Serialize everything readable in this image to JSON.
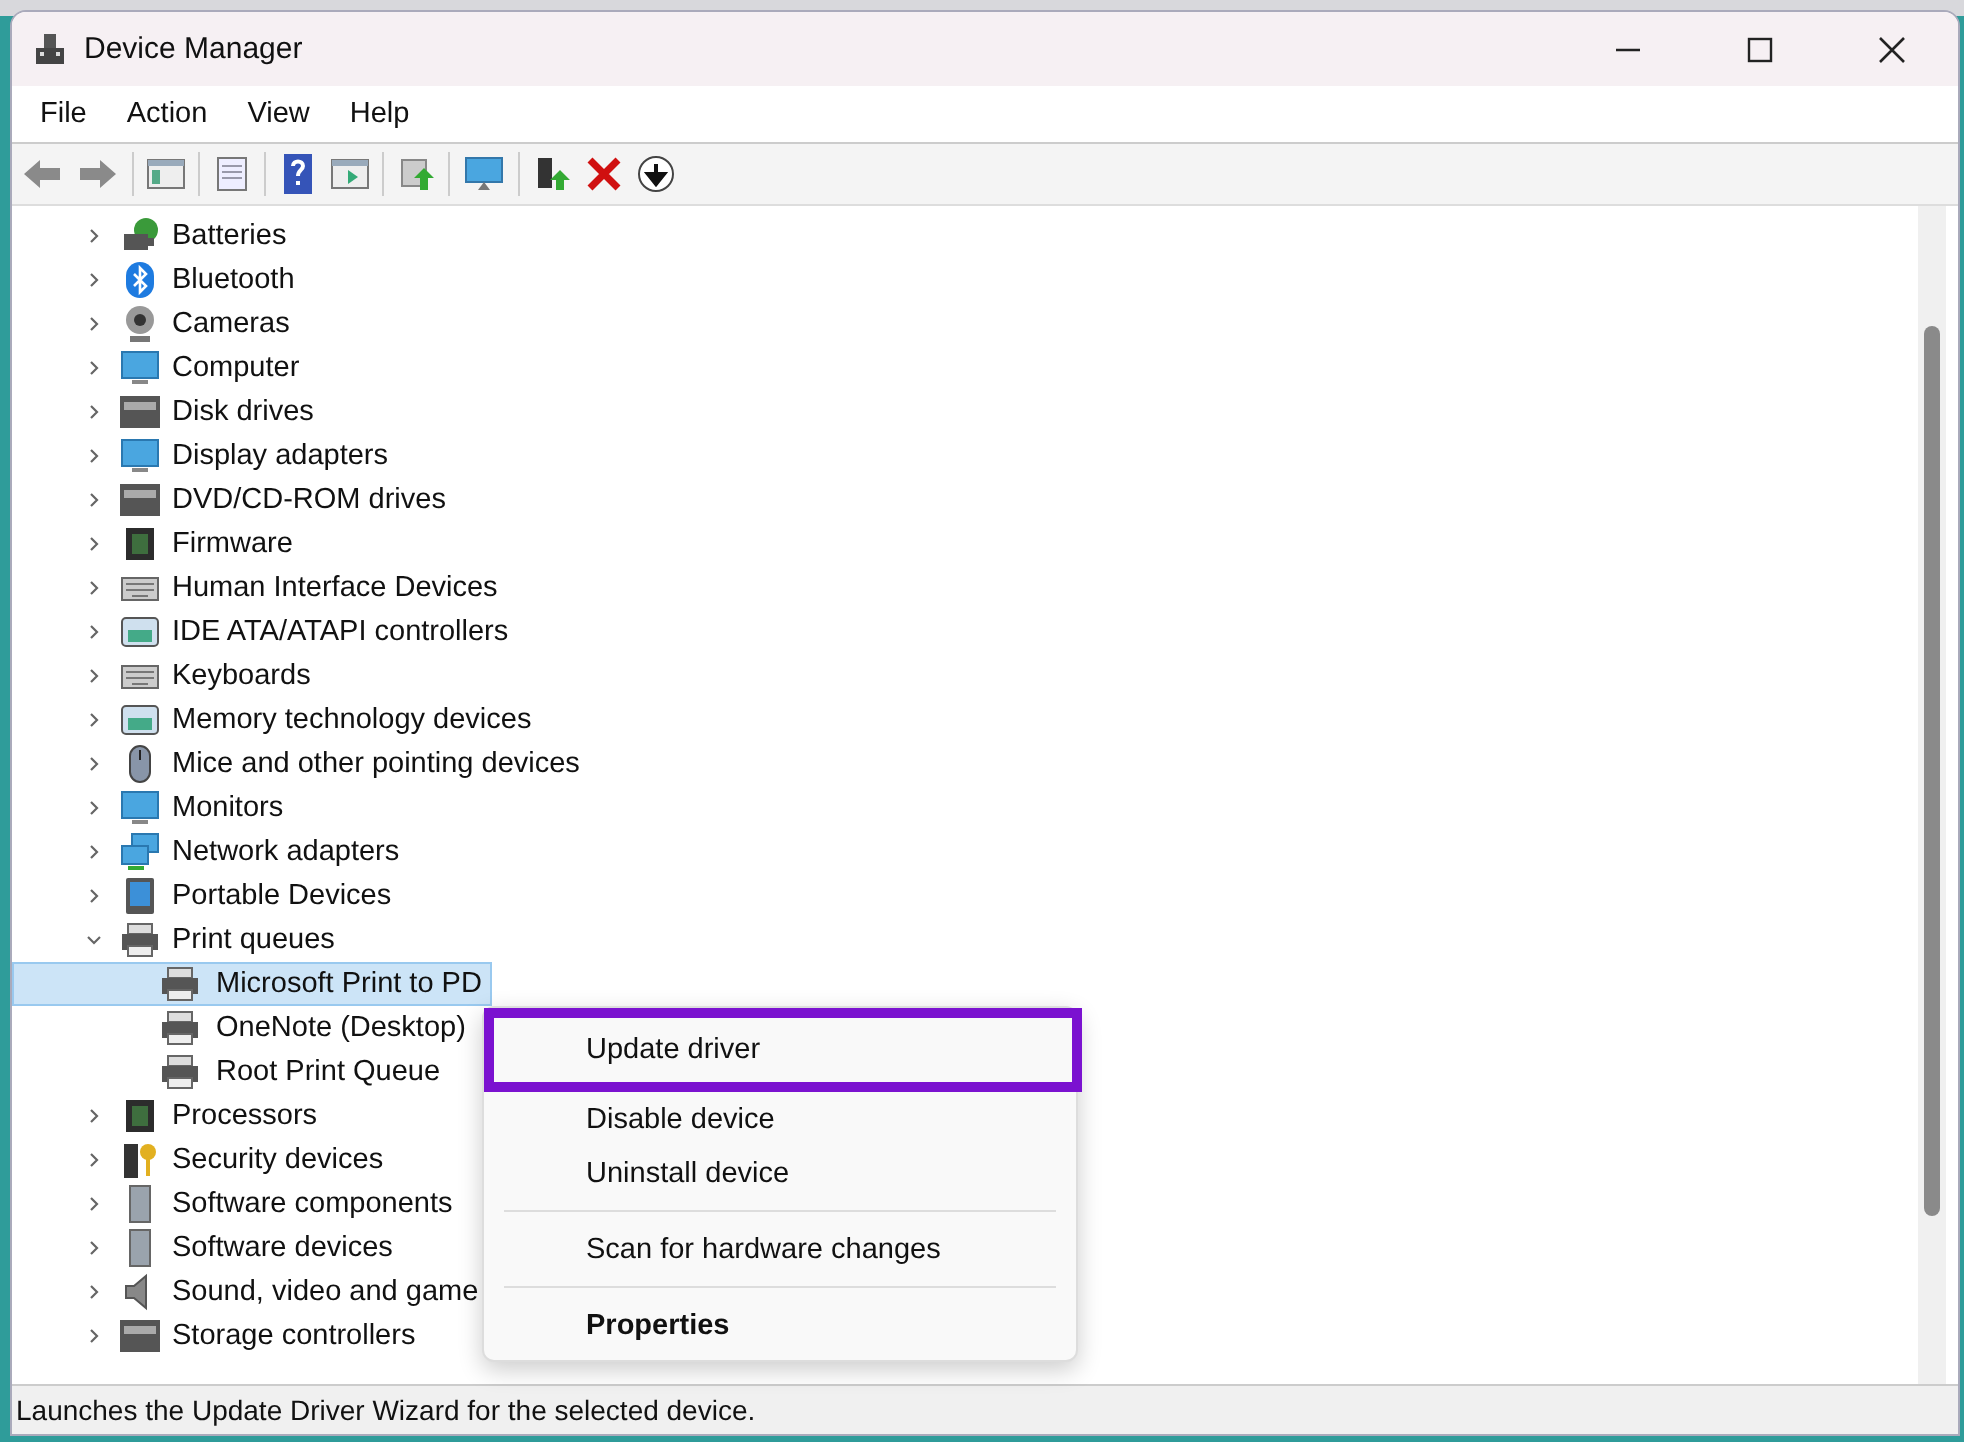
{
  "window": {
    "title": "Device Manager"
  },
  "menu_bar": [
    "File",
    "Action",
    "View",
    "Help"
  ],
  "tree": [
    {
      "label": "Batteries",
      "expanded": false
    },
    {
      "label": "Bluetooth",
      "expanded": false
    },
    {
      "label": "Cameras",
      "expanded": false
    },
    {
      "label": "Computer",
      "expanded": false
    },
    {
      "label": "Disk drives",
      "expanded": false
    },
    {
      "label": "Display adapters",
      "expanded": false
    },
    {
      "label": "DVD/CD-ROM drives",
      "expanded": false
    },
    {
      "label": "Firmware",
      "expanded": false
    },
    {
      "label": "Human Interface Devices",
      "expanded": false
    },
    {
      "label": "IDE ATA/ATAPI controllers",
      "expanded": false
    },
    {
      "label": "Keyboards",
      "expanded": false
    },
    {
      "label": "Memory technology devices",
      "expanded": false
    },
    {
      "label": "Mice and other pointing devices",
      "expanded": false
    },
    {
      "label": "Monitors",
      "expanded": false
    },
    {
      "label": "Network adapters",
      "expanded": false
    },
    {
      "label": "Portable Devices",
      "expanded": false
    },
    {
      "label": "Print queues",
      "expanded": true,
      "children": [
        {
          "label": "Microsoft Print to PD",
          "selected": true
        },
        {
          "label": "OneNote (Desktop)",
          "selected": false
        },
        {
          "label": "Root Print Queue",
          "selected": false
        }
      ]
    },
    {
      "label": "Processors",
      "expanded": false
    },
    {
      "label": "Security devices",
      "expanded": false
    },
    {
      "label": "Software components",
      "expanded": false
    },
    {
      "label": "Software devices",
      "expanded": false
    },
    {
      "label": "Sound, video and game",
      "expanded": false
    },
    {
      "label": "Storage controllers",
      "expanded": false
    }
  ],
  "context_menu": {
    "items": [
      {
        "kind": "item",
        "label": "Update driver",
        "outlined": true,
        "bold": false
      },
      {
        "kind": "item",
        "label": "Disable device",
        "outlined": false,
        "bold": false
      },
      {
        "kind": "item",
        "label": "Uninstall device",
        "outlined": false,
        "bold": false
      },
      {
        "kind": "separator"
      },
      {
        "kind": "item",
        "label": "Scan for hardware changes",
        "outlined": false,
        "bold": false
      },
      {
        "kind": "separator"
      },
      {
        "kind": "item",
        "label": "Properties",
        "outlined": false,
        "bold": true
      }
    ]
  },
  "status_bar": "Launches the Update Driver Wizard for the selected device."
}
